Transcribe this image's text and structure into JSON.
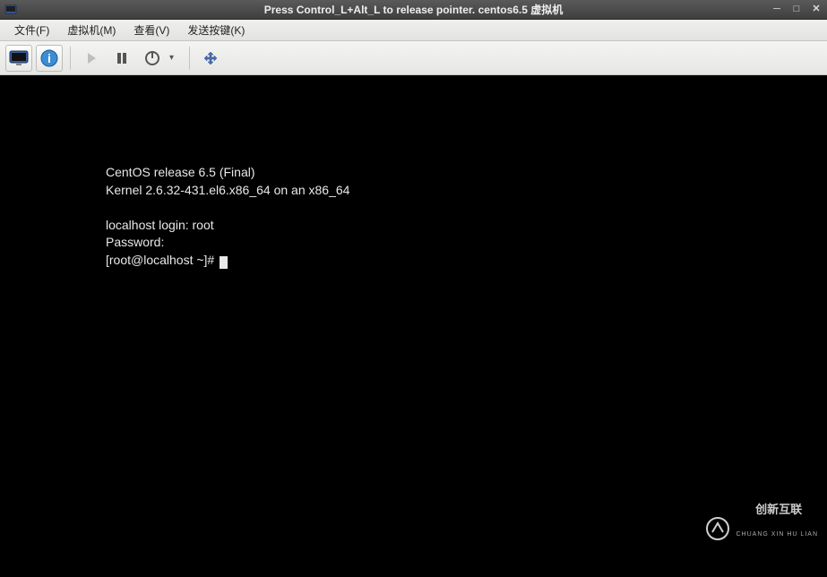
{
  "window": {
    "title": "Press Control_L+Alt_L to release pointer. centos6.5 虚拟机"
  },
  "menubar": {
    "file": "文件(F)",
    "vm": "虚拟机(M)",
    "view": "查看(V)",
    "sendkey": "发送按键(K)"
  },
  "toolbar": {
    "console_icon": "console",
    "info_icon": "info",
    "play_icon": "play",
    "pause_icon": "pause",
    "power_icon": "power",
    "fullscreen_icon": "fullscreen"
  },
  "terminal": {
    "line1": "CentOS release 6.5 (Final)",
    "line2": "Kernel 2.6.32-431.el6.x86_64 on an x86_64",
    "line3": "",
    "line4": "localhost login: root",
    "line5": "Password:",
    "line6": "[root@localhost ~]# "
  },
  "watermark": {
    "main": "创新互联",
    "sub": "CHUANG XIN HU LIAN"
  }
}
